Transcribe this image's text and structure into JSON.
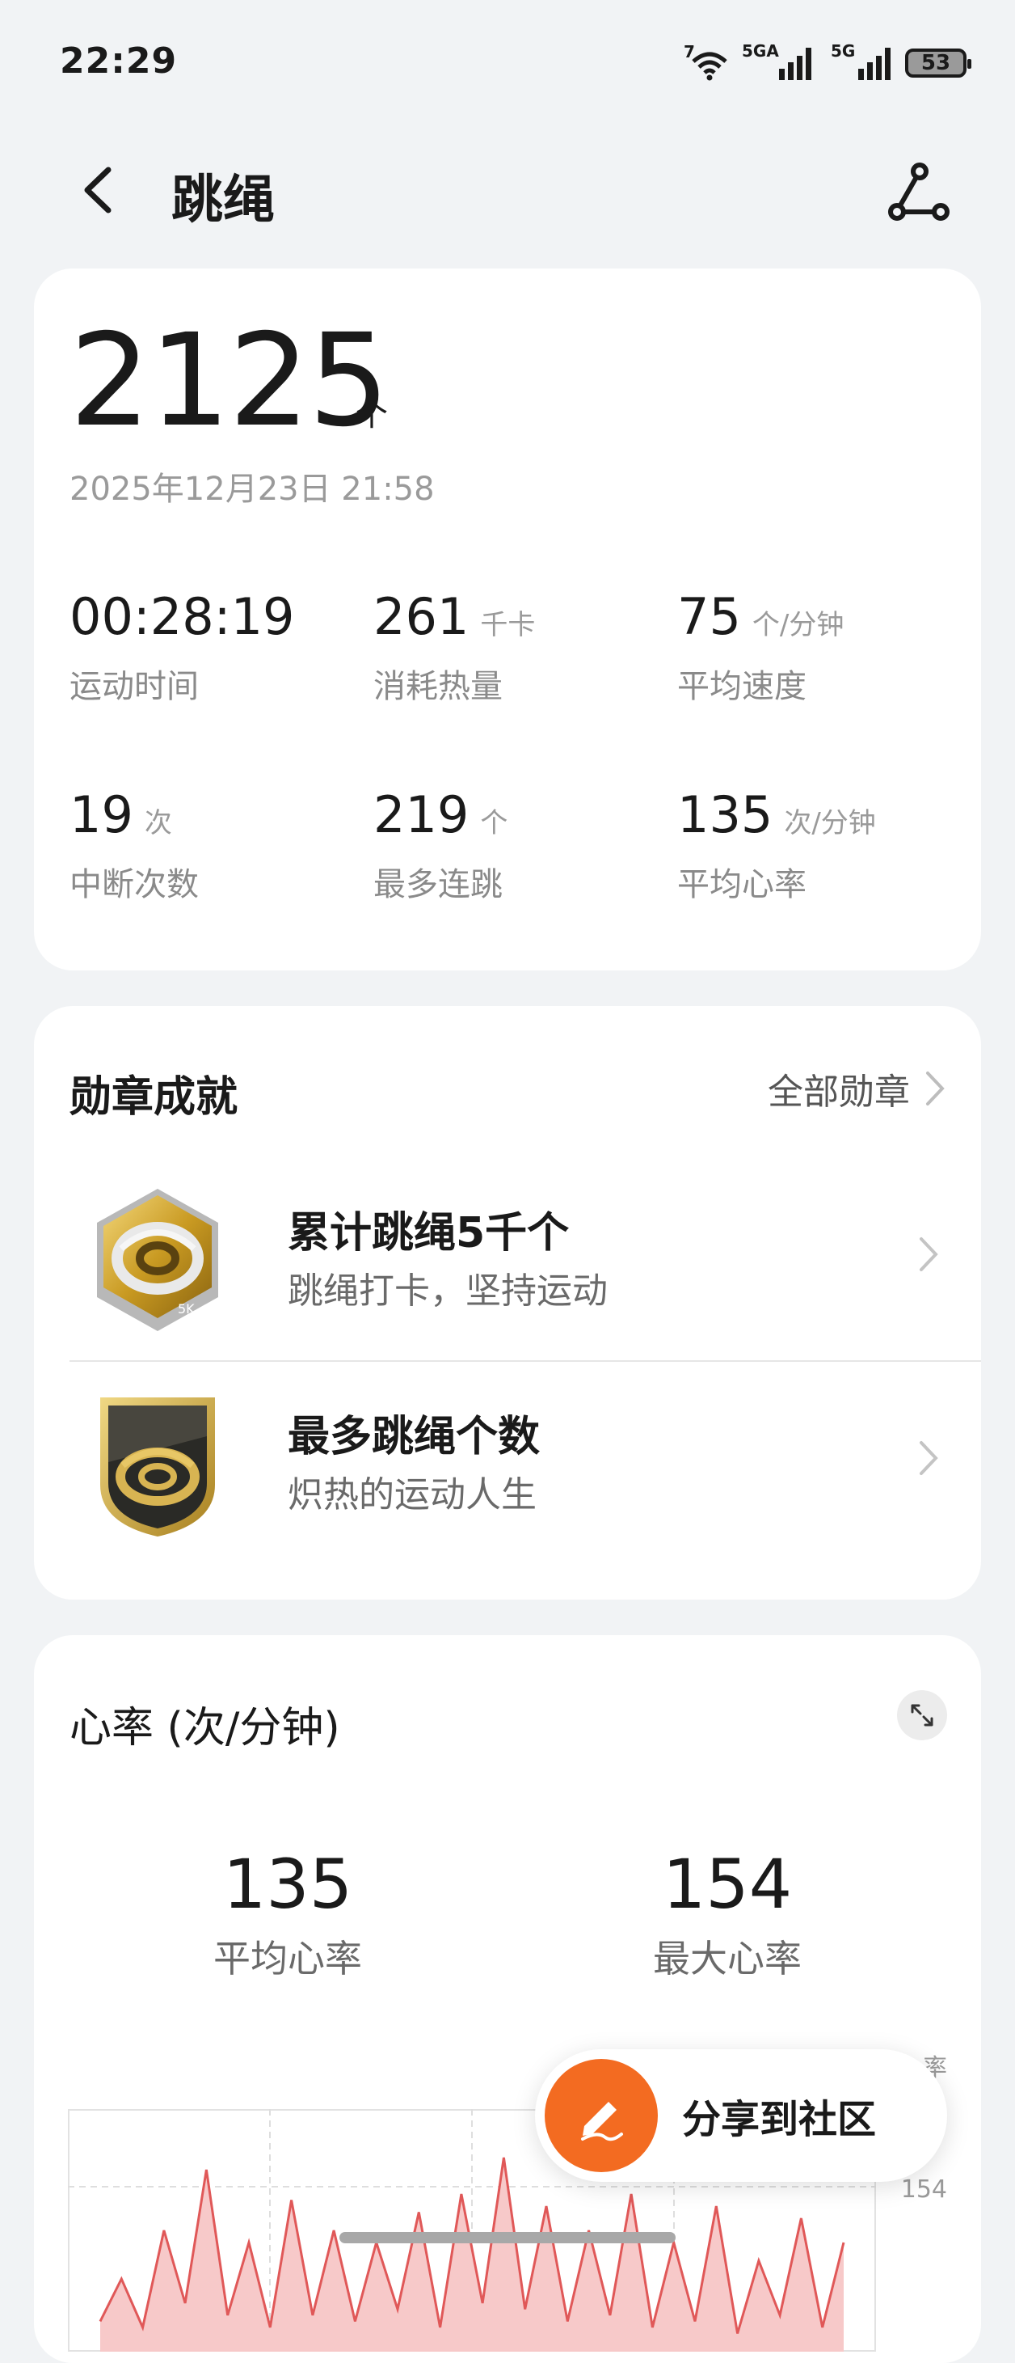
{
  "status_bar": {
    "time": "22:29",
    "wifi_label": "7",
    "sim1_label": "5GA",
    "sim2_label": "5G",
    "battery": "53"
  },
  "header": {
    "title": "跳绳",
    "back_icon": "chevron-left-icon",
    "share_route_icon": "route-share-icon"
  },
  "summary": {
    "count": "2125",
    "count_unit": "个",
    "datetime": "2025年12月23日 21:58",
    "metrics": [
      {
        "value": "00:28:19",
        "unit": "",
        "label": "运动时间"
      },
      {
        "value": "261",
        "unit": "千卡",
        "label": "消耗热量"
      },
      {
        "value": "75",
        "unit": "个/分钟",
        "label": "平均速度"
      },
      {
        "value": "19",
        "unit": "次",
        "label": "中断次数"
      },
      {
        "value": "219",
        "unit": "个",
        "label": "最多连跳"
      },
      {
        "value": "135",
        "unit": "次/分钟",
        "label": "平均心率"
      }
    ]
  },
  "medals": {
    "title": "勋章成就",
    "all_label": "全部勋章",
    "items": [
      {
        "title": "累计跳绳5千个",
        "subtitle": "跳绳打卡，坚持运动",
        "badge_text": "5K"
      },
      {
        "title": "最多跳绳个数",
        "subtitle": "炽热的运动人生"
      }
    ]
  },
  "heart_rate": {
    "title": "心率 (次/分钟)",
    "avg_value": "135",
    "avg_label": "平均心率",
    "max_value": "154",
    "max_label": "最大心率",
    "axis_top_fragment": "率",
    "axis_max_label": "154"
  },
  "chart_data": {
    "type": "area",
    "title": "心率 (次/分钟)",
    "xlabel": "",
    "ylabel": "",
    "y_tick_labels": [
      "154"
    ],
    "values": [
      125,
      132,
      124,
      140,
      128,
      150,
      126,
      138,
      124,
      145,
      126,
      140,
      125,
      138,
      127,
      143,
      124,
      146,
      128,
      152,
      127,
      144,
      125,
      140,
      126,
      146,
      124,
      138,
      125,
      144,
      123,
      135,
      126,
      142,
      124,
      138
    ],
    "ylim": [
      120,
      160
    ],
    "fill_color": "#f7c9c9",
    "line_color": "#e05858",
    "grid": true
  },
  "share": {
    "label": "分享到社区",
    "icon": "pen-icon",
    "accent": "#f36b21"
  }
}
